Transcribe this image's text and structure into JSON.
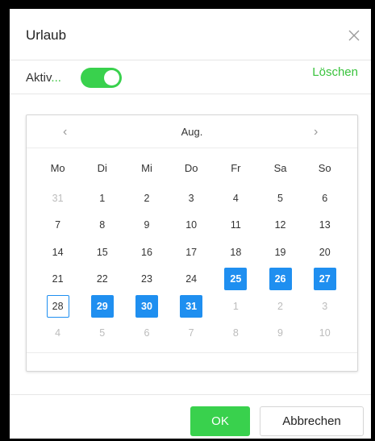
{
  "dialog": {
    "title": "Urlaub",
    "aktiv_label": "Aktiv",
    "aktiv_ellipsis": "...",
    "toggle_on": true,
    "delete_label": "Löschen",
    "ok_label": "OK",
    "cancel_label": "Abbrechen"
  },
  "calendar": {
    "prev": "‹",
    "next": "›",
    "month": "Aug.",
    "weekdays": [
      "Mo",
      "Di",
      "Mi",
      "Do",
      "Fr",
      "Sa",
      "So"
    ],
    "weeks": [
      [
        {
          "d": "31",
          "m": true
        },
        {
          "d": "1"
        },
        {
          "d": "2"
        },
        {
          "d": "3"
        },
        {
          "d": "4"
        },
        {
          "d": "5"
        },
        {
          "d": "6"
        }
      ],
      [
        {
          "d": "7"
        },
        {
          "d": "8"
        },
        {
          "d": "9"
        },
        {
          "d": "10"
        },
        {
          "d": "11"
        },
        {
          "d": "12"
        },
        {
          "d": "13"
        }
      ],
      [
        {
          "d": "14"
        },
        {
          "d": "15"
        },
        {
          "d": "16"
        },
        {
          "d": "17"
        },
        {
          "d": "18"
        },
        {
          "d": "19"
        },
        {
          "d": "20"
        }
      ],
      [
        {
          "d": "21"
        },
        {
          "d": "22"
        },
        {
          "d": "23"
        },
        {
          "d": "24"
        },
        {
          "d": "25",
          "s": true
        },
        {
          "d": "26",
          "s": true
        },
        {
          "d": "27",
          "s": true
        }
      ],
      [
        {
          "d": "28",
          "t": true
        },
        {
          "d": "29",
          "s": true
        },
        {
          "d": "30",
          "s": true
        },
        {
          "d": "31",
          "s": true
        },
        {
          "d": "1",
          "m": true
        },
        {
          "d": "2",
          "m": true
        },
        {
          "d": "3",
          "m": true
        }
      ],
      [
        {
          "d": "4",
          "m": true
        },
        {
          "d": "5",
          "m": true
        },
        {
          "d": "6",
          "m": true
        },
        {
          "d": "7",
          "m": true
        },
        {
          "d": "8",
          "m": true
        },
        {
          "d": "9",
          "m": true
        },
        {
          "d": "10",
          "m": true
        }
      ]
    ]
  },
  "colors": {
    "accent_green": "#39d14d",
    "selection_blue": "#1f8ff0"
  }
}
